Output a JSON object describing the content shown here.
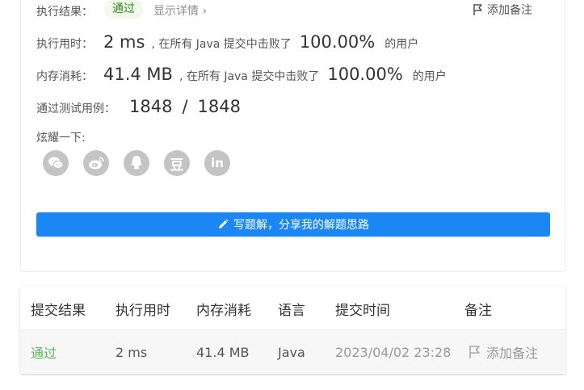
{
  "result": {
    "label": "执行结果：",
    "status": "通过",
    "details_link": "显示详情",
    "details_chevron": "›",
    "add_note": "添加备注"
  },
  "runtime": {
    "label": "执行用时：",
    "value": "2 ms",
    "beat_prefix": ", 在所有 Java 提交中击败了",
    "percent": "100.00%",
    "suffix": "的用户"
  },
  "memory": {
    "label": "内存消耗：",
    "value": "41.4 MB",
    "beat_prefix": ", 在所有 Java 提交中击败了",
    "percent": "100.00%",
    "suffix": "的用户"
  },
  "tests": {
    "label": "通过测试用例：",
    "passed": "1848",
    "separator": "/",
    "total": "1848"
  },
  "share": {
    "label": "炫耀一下:",
    "icons": [
      "wechat-icon",
      "weibo-icon",
      "qq-icon",
      "douban-icon",
      "linkedin-icon"
    ],
    "douban_glyph": "豆",
    "linkedin_glyph": "in"
  },
  "cta": {
    "label": "写题解，分享我的解题思路"
  },
  "table": {
    "headers": [
      "提交结果",
      "执行用时",
      "内存消耗",
      "语言",
      "提交时间",
      "备注"
    ],
    "rows": [
      {
        "status": "通过",
        "runtime": "2 ms",
        "memory": "41.4 MB",
        "language": "Java",
        "time": "2023/04/02 23:28",
        "note": "添加备注"
      }
    ]
  },
  "colors": {
    "accent": "#1a87f5",
    "success": "#5cb85c",
    "share_gray": "#c4c4c4"
  }
}
